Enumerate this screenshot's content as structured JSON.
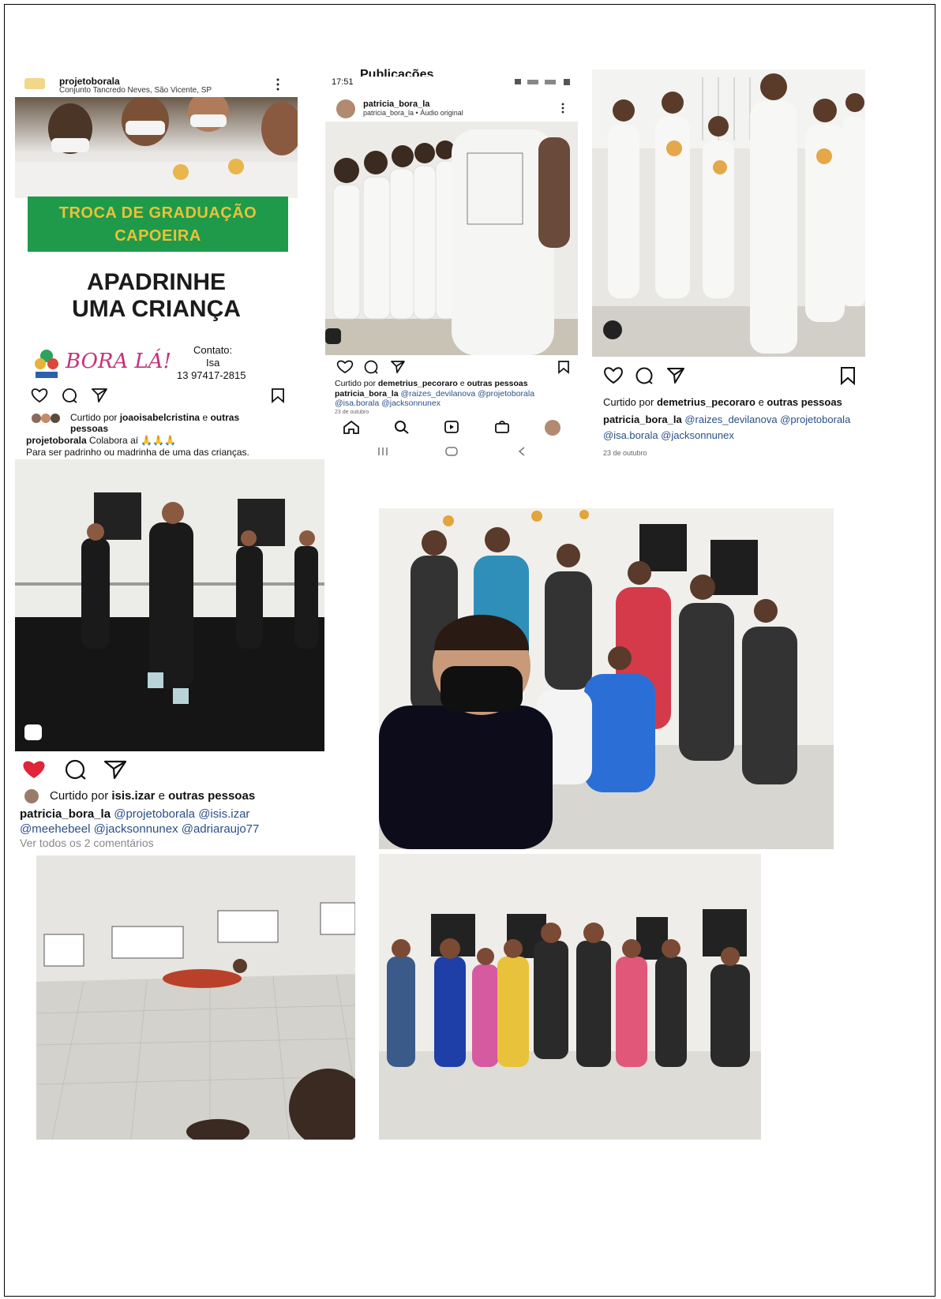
{
  "post1": {
    "username": "projetoborala",
    "location": "Conjunto Tancredo Neves, São Vicente, SP",
    "banner_line1": "TROCA DE GRADUAÇÃO",
    "banner_line2": "CAPOEIRA",
    "headline_line1": "APADRINHE",
    "headline_line2": "UMA CRIANÇA",
    "brand": "BORA LÁ!",
    "contact_label": "Contato:",
    "contact_name": "Isa",
    "contact_phone": "13 97417-2815",
    "liked_prefix": "Curtido por",
    "liked_user": "joaoisabelcristina",
    "liked_mid": "e",
    "liked_suffix": "outras",
    "liked_suffix2": "pessoas",
    "caption_user": "projetoborala",
    "caption_text": "Colabora aí 🙏🙏🙏",
    "caption_line2": "Para ser padrinho ou madrinha de uma das crianças."
  },
  "post2": {
    "status_time": "17:51",
    "header_cut": "Publicações",
    "username": "patricia_bora_la",
    "subtitle": "patricia_bora_la • Áudio original",
    "liked_prefix": "Curtido por",
    "liked_user": "demetrius_pecoraro",
    "liked_mid": "e",
    "liked_suffix": "outras pessoas",
    "caption_user": "patricia_bora_la",
    "caption_tags1": "@raizes_devilanova @projetoborala",
    "caption_tags2": "@isa.borala @jacksonnunex",
    "date": "23 de outubro"
  },
  "post3": {
    "liked_prefix": "Curtido por",
    "liked_user": "demetrius_pecoraro",
    "liked_mid": "e",
    "liked_suffix": "outras pessoas",
    "caption_user": "patricia_bora_la",
    "caption_tags1": "@raizes_devilanova @projetoborala",
    "caption_tags2": "@isa.borala @jacksonnunex",
    "date": "23 de outubro"
  },
  "post4": {
    "liked_prefix": "Curtido por",
    "liked_user": "isis.izar",
    "liked_mid": "e",
    "liked_suffix": "outras pessoas",
    "caption_user": "patricia_bora_la",
    "caption_tags1": "@projetoborala @isis.izar",
    "caption_tags2": "@meehebeel @jacksonnunex @adriaraujo77",
    "comments": "Ver todos os 2 comentários"
  },
  "colors": {
    "banner_green": "#1f9a4a",
    "banner_text": "#e9c23a",
    "like_red": "#e0243a",
    "tag_blue": "#2a4f8a"
  }
}
